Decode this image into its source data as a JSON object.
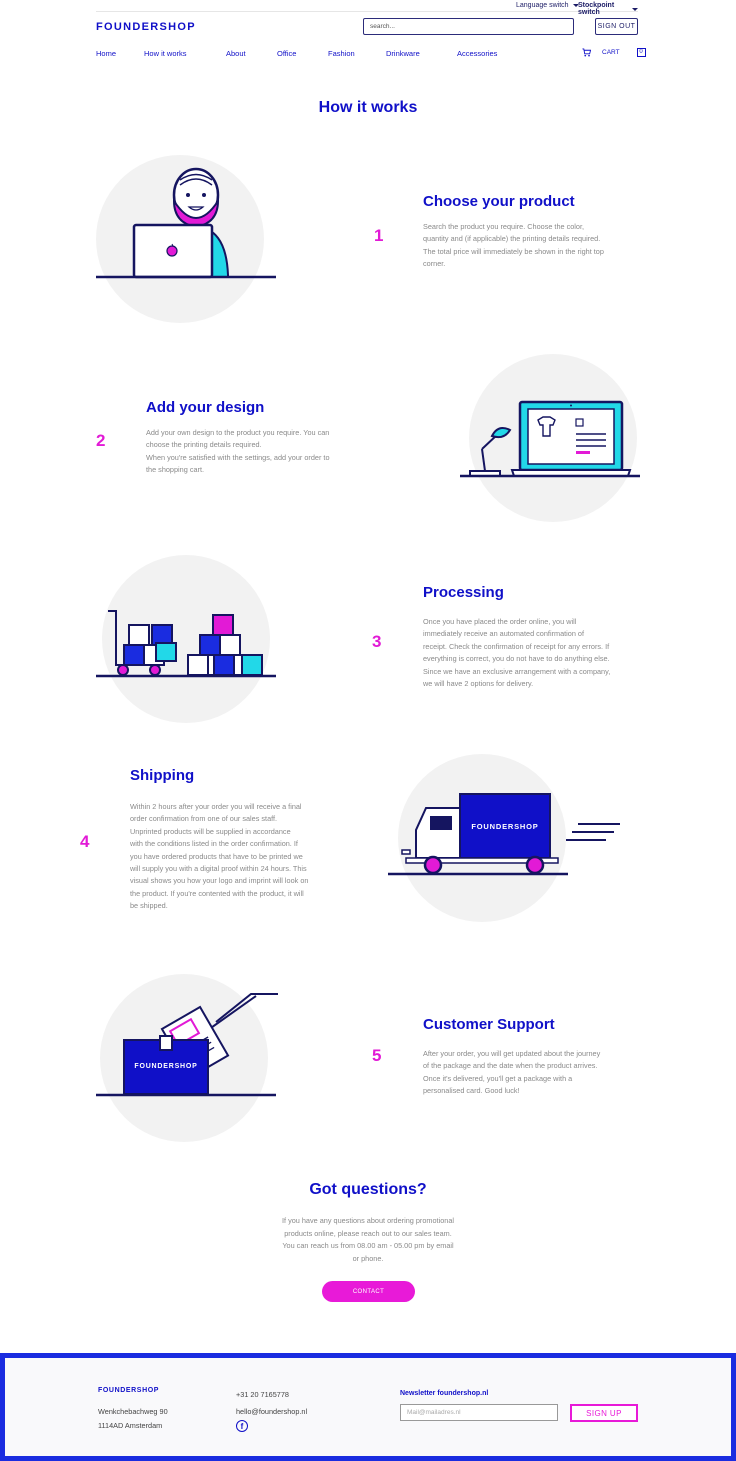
{
  "topbar": {
    "language_switch": "Language switch",
    "stockpoint_switch": "Stockpoint switch"
  },
  "header": {
    "logo": "FOUNDERSHOP",
    "search_placeholder": "search...",
    "signout_label": "SIGN OUT"
  },
  "nav": {
    "items": [
      "Home",
      "How it works",
      "About",
      "Office",
      "Fashion",
      "Drinkware",
      "Accessories"
    ],
    "cart_label": "CART",
    "cart_count": "0"
  },
  "page_title": "How it works",
  "steps": [
    {
      "number": "1",
      "title": "Choose your product",
      "lines": [
        "Search the product you require. Choose the color,",
        "quantity and (if applicable) the printing details required.",
        "The total price will immediately be shown in the right top",
        "corner."
      ]
    },
    {
      "number": "2",
      "title": "Add your design",
      "lines": [
        "Add your own design to the product you require. You can",
        "choose the printing details required.",
        "When you're satisfied with the settings, add your order to",
        "the shopping cart."
      ]
    },
    {
      "number": "3",
      "title": "Processing",
      "lines": [
        "Once you have placed the order online, you will",
        "immediately receive an automated confirmation of",
        "receipt. Check the confirmation of receipt for any errors. If",
        "everything is correct, you do not have to do anything else.",
        "Since we have an exclusive arrangement with a company,",
        "we will have 2 options for delivery."
      ]
    },
    {
      "number": "4",
      "title": "Shipping",
      "lines": [
        "Within 2 hours after your order you will receive a final",
        "order confirmation from one of our sales staff.",
        "Unprinted products will be supplied in accordance",
        "with the conditions listed in the order confirmation. If",
        "you have ordered products that have to be printed we",
        "will supply you with a digital proof within 24 hours. This",
        "visual shows you how your logo and imprint will look on",
        "the product. If you're contented with the product, it will",
        "be shipped."
      ]
    },
    {
      "number": "5",
      "title": "Customer Support",
      "lines": [
        "After your order, you will get updated about the journey",
        "of the package and the date when the product arrives.",
        "Once it's delivered, you'll get a package with a",
        "personalised card. Good luck!"
      ]
    }
  ],
  "illustration_labels": {
    "truck_brand": "FOUNDERSHOP",
    "box_brand": "FOUNDERSHOP"
  },
  "questions": {
    "title": "Got questions?",
    "lines": [
      "If you have any questions about ordering promotional",
      "products online, please reach out to our sales team.",
      "You can reach us from 08.00 am - 05.00 pm by email",
      "or phone."
    ],
    "contact_label": "CONTACT"
  },
  "footer": {
    "logo": "FOUNDERSHOP",
    "street": "Wenkchebachweg 90",
    "city": "1114AD Amsterdam",
    "phone": "+31 20 7165778",
    "email": "hello@foundershop.nl",
    "facebook_glyph": "f",
    "newsletter_title": "Newsletter foundershop.nl",
    "newsletter_placeholder": "Mail@mailadres.nl",
    "signup_label": "SIGN UP"
  },
  "colors": {
    "brand_blue": "#1010c8",
    "accent_magenta": "#e21ad6",
    "cyan": "#22d8e8",
    "navy": "#151560",
    "circle_gray": "#f2f2f2"
  }
}
